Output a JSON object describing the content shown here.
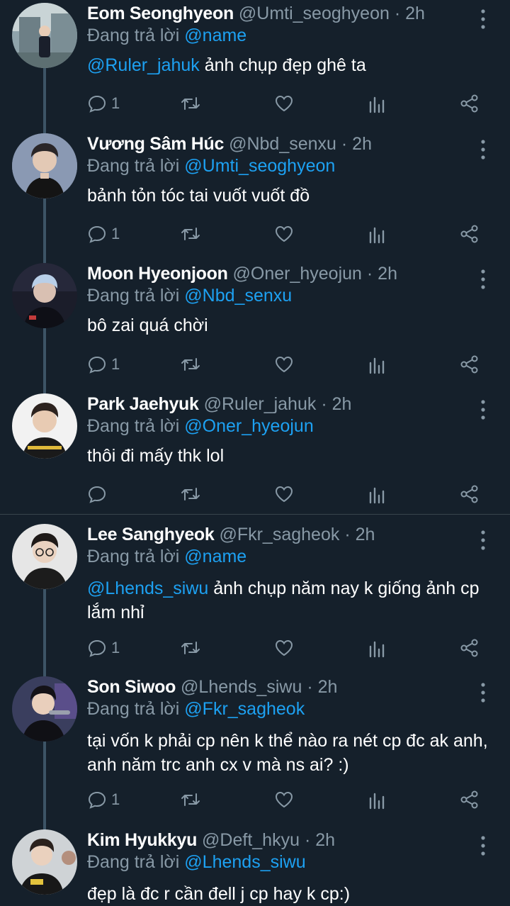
{
  "colors": {
    "background": "#15202b",
    "text": "#ffffff",
    "muted": "#8899a6",
    "mention": "#1da1f2",
    "thread_line": "#3d5466",
    "divider": "#38444d"
  },
  "reply_prefix": "Đang trả lời",
  "tweets": [
    {
      "name": "Eom Seonghyeon",
      "handle": "@Umti_seoghyeon",
      "time": "2h",
      "reply_to": "@name",
      "mention": "@Ruler_jahuk",
      "text": " ảnh chụp đẹp ghê ta",
      "reply_count": "1",
      "avatar_icon": "user-photo-outdoor"
    },
    {
      "name": "Vương Sâm Húc",
      "handle": "@Nbd_senxu",
      "time": "2h",
      "reply_to": "@Umti_seoghyeon",
      "mention": "",
      "text": "bảnh tỏn tóc tai vuốt vuốt đồ",
      "reply_count": "1",
      "avatar_icon": "user-photo-portrait"
    },
    {
      "name": "Moon Hyeonjoon",
      "handle": "@Oner_hyeojun",
      "time": "2h",
      "reply_to": "@Nbd_senxu",
      "mention": "",
      "text": "bô zai quá chời",
      "reply_count": "1",
      "avatar_icon": "user-photo-dark"
    },
    {
      "name": "Park Jaehyuk",
      "handle": "@Ruler_jahuk",
      "time": "2h",
      "reply_to": "@Oner_hyeojun",
      "mention": "",
      "text": "thôi đi mấy thk lol",
      "reply_count": "",
      "avatar_icon": "user-photo-jersey"
    },
    {
      "name": "Lee Sanghyeok",
      "handle": "@Fkr_sagheok",
      "time": "2h",
      "reply_to": "@name",
      "mention": "@Lhends_siwu",
      "text": " ảnh chụp năm nay k giống ảnh cp lắm nhỉ",
      "reply_count": "1",
      "avatar_icon": "user-photo-glasses"
    },
    {
      "name": "Son Siwoo",
      "handle": "@Lhends_siwu",
      "time": "2h",
      "reply_to": "@Fkr_sagheok",
      "mention": "",
      "text": "tại vốn k phải cp nên k thể nào ra nét cp đc ak anh, anh năm trc anh cx v mà ns ai? :)",
      "reply_count": "1",
      "avatar_icon": "user-photo-mic"
    },
    {
      "name": "Kim Hyukkyu",
      "handle": "@Deft_hkyu",
      "time": "2h",
      "reply_to": "@Lhends_siwu",
      "mention": "",
      "text": "đẹp là đc r cần đell j cp hay k cp:)",
      "reply_count": "",
      "avatar_icon": "user-photo-group"
    }
  ]
}
